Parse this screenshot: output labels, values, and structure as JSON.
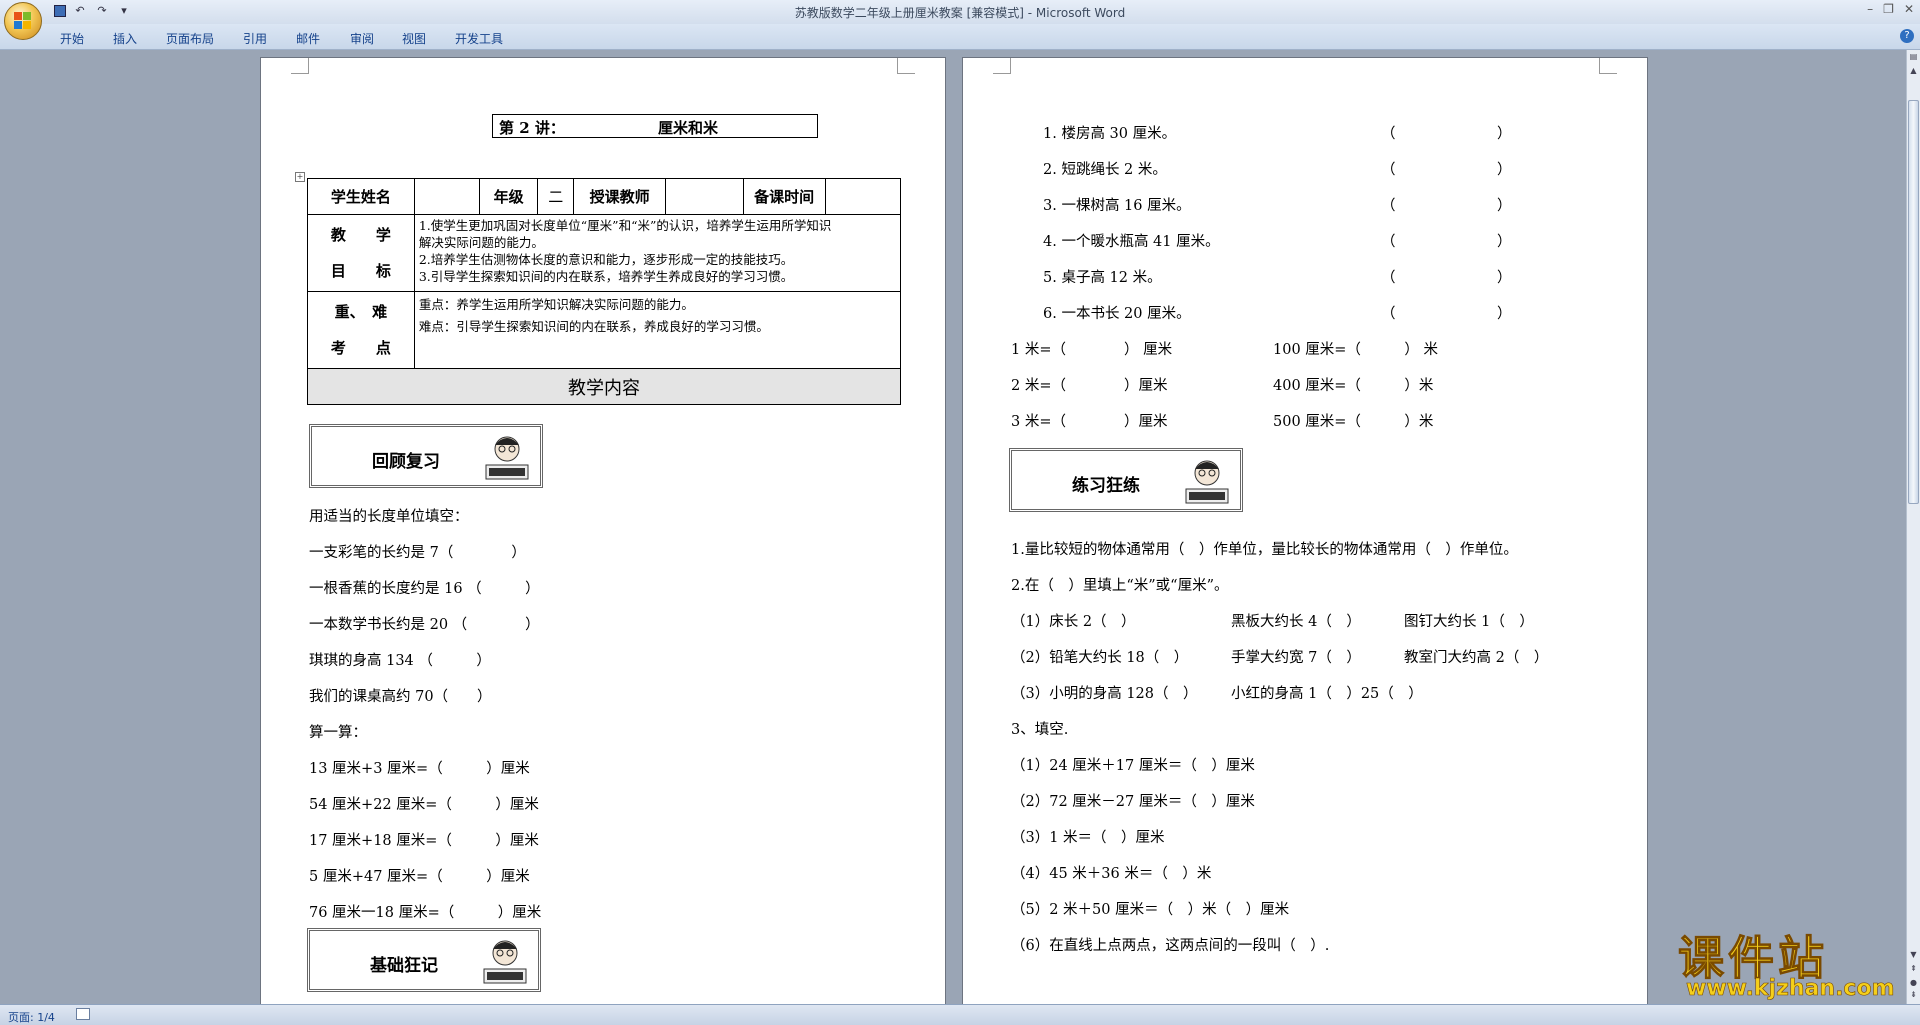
{
  "window": {
    "title": "苏教版数学二年级上册厘米教案 [兼容模式] - Microsoft Word"
  },
  "ribbon": {
    "tabs": [
      "开始",
      "插入",
      "页面布局",
      "引用",
      "邮件",
      "审阅",
      "视图",
      "开发工具"
    ]
  },
  "status": {
    "page": "页面: 1/4"
  },
  "left_page": {
    "title_left": "第 2 讲：",
    "title_right": "厘米和米",
    "table": {
      "name_label": "学生姓名",
      "grade_label": "年级",
      "grade_value": "二",
      "teacher_label": "授课教师",
      "time_label": "备课时间",
      "goal_label_1": "教　　学",
      "goal_label_2": "目　　标",
      "goal_1": "1.使学生更加巩固对长度单位“厘米”和“米”的认识，培养学生运用所学知识",
      "goal_1b": "解决实际问题的能力。",
      "goal_2": "2.培养学生估测物体长度的意识和能力，逐步形成一定的技能技巧。",
      "goal_3": "3.引导学生探索知识间的内在联系，培养学生养成良好的学习习惯。",
      "key_label_1": "重、　难",
      "key_label_2": "考　　点",
      "key_1": "重点：养学生运用所学知识解决实际问题的能力。",
      "key_2": "难点：引导学生探索知识间的内在联系，养成良好的学习习惯。",
      "content_header": "教学内容"
    },
    "section_review": "回顾复习",
    "fill_intro": "用适当的长度单位填空：",
    "fill": [
      "一支彩笔的长约是 7（　　　　）",
      "一根香蕉的长度约是 16 （　　　）",
      "一本数学书长约是 20 （　　　　）",
      "琪琪的身高 134 （　　　）",
      "我们的课桌高约 70（　　）"
    ],
    "calc_intro": "算一算：",
    "calc": [
      "13 厘米+3 厘米=（　　　）厘米",
      "54 厘米+22 厘米=（　　　）厘米",
      "17 厘米+18 厘米=（　　　）厘米",
      "5 厘米+47 厘米=（　　　）厘米",
      "76 厘米一18 厘米=（　　　）厘米"
    ],
    "section_basic": "基础狂记"
  },
  "right_page": {
    "judge": [
      {
        "q": "1.  楼房高 30 厘米。",
        "a": "（　　　　　　　）"
      },
      {
        "q": "2.  短跳绳长 2 米。",
        "a": "（　　　　　　　）"
      },
      {
        "q": "3.  一棵树高 16 厘米。",
        "a": "（　　　　　　　）"
      },
      {
        "q": "4.  一个暖水瓶高 41 厘米。",
        "a": "（　　　　　　　）"
      },
      {
        "q": "5.  桌子高 12 米。",
        "a": "（　　　　　　　）"
      },
      {
        "q": "6.  一本书长 20 厘米。",
        "a": "（　　　　　　　）"
      }
    ],
    "conv": [
      {
        "l": "1 米=（　　　　） 厘米",
        "r": "100 厘米=（　　　） 米"
      },
      {
        "l": "2 米=（　　　　）厘米",
        "r": "400 厘米=（　　　）米"
      },
      {
        "l": "3 米=（　　　　）厘米",
        "r": "500 厘米=（　　　）米"
      }
    ],
    "section_practice": "练习狂练",
    "p1": "1.量比较短的物体通常用（　）作单位，量比较长的物体通常用（　）作单位。",
    "p2": "2.在（　）里填上“米”或“厘米”。",
    "p2_rows": [
      [
        "（1）床长 2（　）",
        "黑板大约长 4（　）",
        "图钉大约长 1（　）"
      ],
      [
        "（2）铅笔大约长 18（　）",
        "手掌大约宽 7（　）",
        "教室门大约高 2（　）"
      ],
      [
        "（3）小明的身高 128（　）",
        "小红的身高 1（　）25（　）"
      ]
    ],
    "p3": "3、填空.",
    "p3_items": [
      "（1）24 厘米＋17 厘米＝（　）厘米",
      "（2）72 厘米－27 厘米＝（　）厘米",
      "（3）1 米＝（　）厘米",
      "（4）45 米＋36 米＝（　）米",
      "（5）2 米＋50 厘米＝（　）米（　）厘米",
      "（6）在直线上点两点，这两点间的一段叫（　）."
    ]
  },
  "watermark": {
    "cn": "课件站",
    "url": "www.kjzhan.com"
  }
}
